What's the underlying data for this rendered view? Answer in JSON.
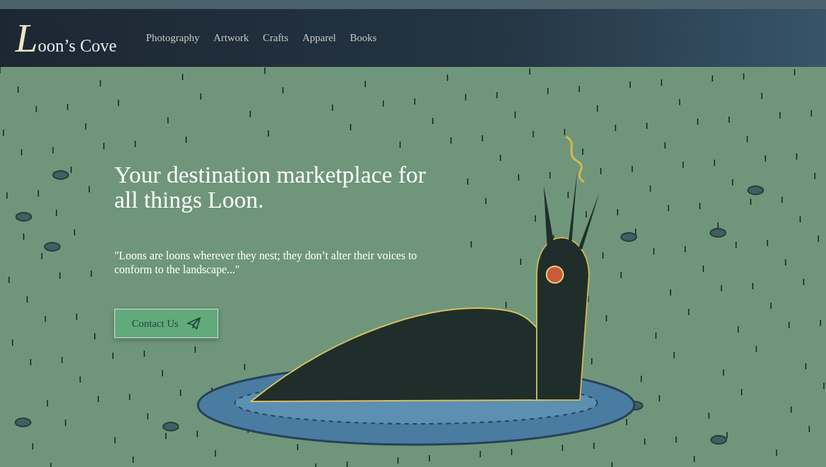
{
  "header": {
    "logo": "Loon’s Cove",
    "nav": [
      "Photography",
      "Artwork",
      "Crafts",
      "Apparel",
      "Books"
    ]
  },
  "hero": {
    "headline": "Your destination marketplace for all things Loon.",
    "quote": "\"Loons are loons wherever they nest; they don’t alter their voices to conform to the landscape...\"",
    "button": "Contact Us"
  }
}
